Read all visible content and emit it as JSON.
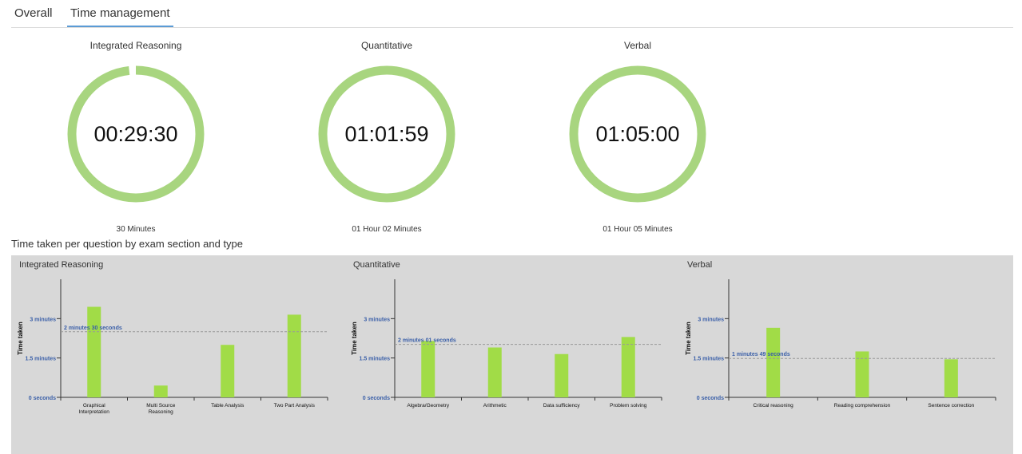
{
  "tabs": [
    {
      "label": "Overall",
      "active": false
    },
    {
      "label": "Time management",
      "active": true
    }
  ],
  "timers": [
    {
      "title": "Integrated Reasoning",
      "time": "00:29:30",
      "limit": "30 Minutes",
      "fraction_used": 0.983
    },
    {
      "title": "Quantitative",
      "time": "01:01:59",
      "limit": "01 Hour 02 Minutes",
      "fraction_used": 1.0
    },
    {
      "title": "Verbal",
      "time": "01:05:00",
      "limit": "01 Hour 05 Minutes",
      "fraction_used": 1.0
    }
  ],
  "section_title": "Time taken per question by exam section and type",
  "colors": {
    "ring": "#a8d57f",
    "bar": "#a1dc47",
    "axis_label": "#3a5fa8",
    "panel": "#d8d8d8",
    "tab_underline": "#5b9bd5"
  },
  "chart_data": [
    {
      "type": "bar",
      "title": "Integrated Reasoning",
      "ylabel": "Time taken",
      "ylim": [
        0,
        4.5
      ],
      "yticks": [
        0,
        1.5,
        3
      ],
      "ytick_labels": [
        "0 seconds",
        "1.5 minutes",
        "3 minutes"
      ],
      "categories": [
        "Graphical Interpretation",
        "Multi Source Reasoning",
        "Table Analysis",
        "Two Part Analysis"
      ],
      "category_lines": [
        [
          "Graphical",
          "Interpretation"
        ],
        [
          "Multi Source",
          "Reasoning"
        ],
        [
          "Table Analysis"
        ],
        [
          "Two Part Analysis"
        ]
      ],
      "values": [
        3.45,
        0.45,
        2.0,
        3.15
      ],
      "reference": {
        "value": 2.5,
        "label": "2 minutes 30 seconds"
      }
    },
    {
      "type": "bar",
      "title": "Quantitative",
      "ylabel": "Time taken",
      "ylim": [
        0,
        4.5
      ],
      "yticks": [
        0,
        1.5,
        3
      ],
      "ytick_labels": [
        "0 seconds",
        "1.5 minutes",
        "3 minutes"
      ],
      "categories": [
        "Algebra/Geometry",
        "Arithmetic",
        "Data sufficiency",
        "Problem solving"
      ],
      "category_lines": [
        [
          "Algebra/Geometry"
        ],
        [
          "Arithmetic"
        ],
        [
          "Data sufficiency"
        ],
        [
          "Problem solving"
        ]
      ],
      "values": [
        2.15,
        1.9,
        1.65,
        2.3
      ],
      "reference": {
        "value": 2.017,
        "label": "2 minutes 01 seconds"
      }
    },
    {
      "type": "bar",
      "title": "Verbal",
      "ylabel": "Time taken",
      "ylim": [
        0,
        4.5
      ],
      "yticks": [
        0,
        1.5,
        3
      ],
      "ytick_labels": [
        "0 seconds",
        "1.5 minutes",
        "3 minutes"
      ],
      "categories": [
        "Critical reasoning",
        "Reading comprehension",
        "Sentence correction"
      ],
      "category_lines": [
        [
          "Critical reasoning"
        ],
        [
          "Reading comprehension"
        ],
        [
          "Sentence correction"
        ]
      ],
      "values": [
        2.65,
        1.75,
        1.45
      ],
      "reference": {
        "value": 1.483,
        "label": "1 minutes 49 seconds"
      }
    }
  ]
}
